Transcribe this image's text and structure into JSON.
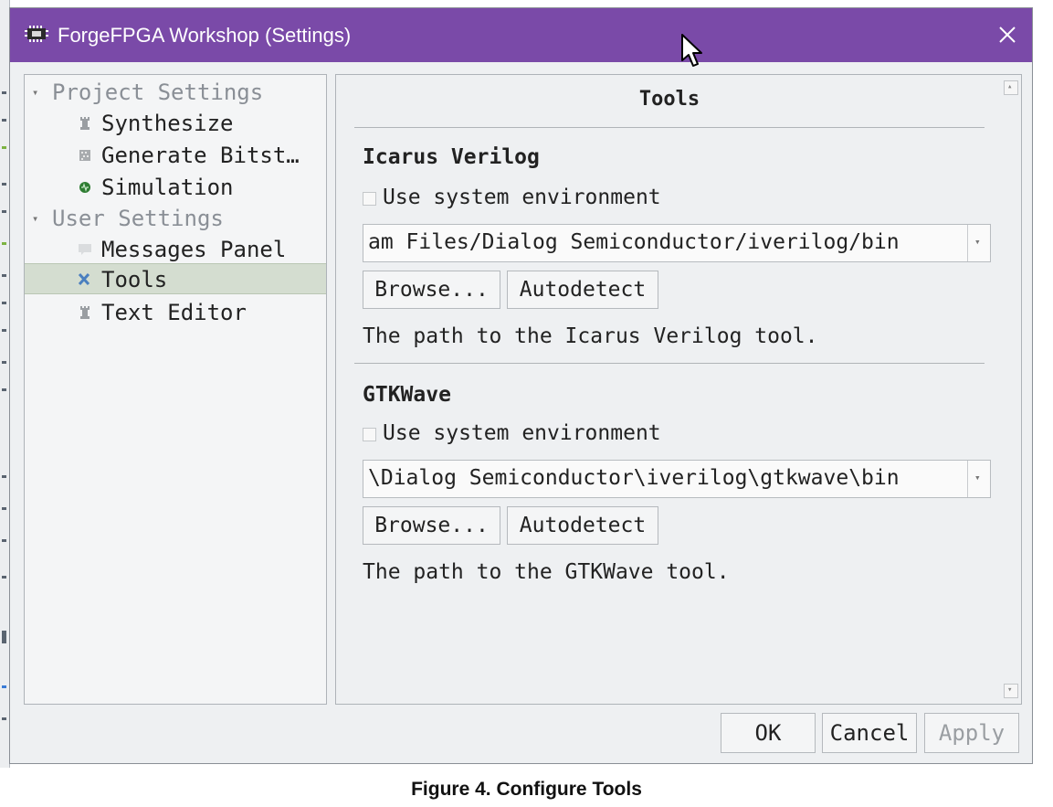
{
  "window": {
    "title": "ForgeFPGA Workshop (Settings)"
  },
  "tree": {
    "project_group": "Project Settings",
    "synthesize": "Synthesize",
    "generate_bitstream": "Generate Bitst…",
    "simulation": "Simulation",
    "user_group": "User Settings",
    "messages_panel": "Messages Panel",
    "tools": "Tools",
    "text_editor": "Text Editor",
    "selected": "Tools"
  },
  "content": {
    "heading": "Tools",
    "icarus": {
      "name": "Icarus Verilog",
      "use_system_env": "Use system environment",
      "use_system_env_checked": false,
      "path": "am Files/Dialog Semiconductor/iverilog/bin",
      "browse": "Browse...",
      "autodetect": "Autodetect",
      "description": "The path to the Icarus Verilog tool."
    },
    "gtkwave": {
      "name": "GTKWave",
      "use_system_env": "Use system environment",
      "use_system_env_checked": false,
      "path": "\\Dialog Semiconductor\\iverilog\\gtkwave\\bin",
      "browse": "Browse...",
      "autodetect": "Autodetect",
      "description": "The path to the GTKWave tool."
    }
  },
  "footer": {
    "ok": "OK",
    "cancel": "Cancel",
    "apply": "Apply",
    "apply_enabled": false
  },
  "caption": "Figure 4. Configure Tools",
  "colors": {
    "titlebar": "#7a4aa8",
    "selection": "#d4ddd0",
    "dialog_bg": "#eef0f2"
  }
}
